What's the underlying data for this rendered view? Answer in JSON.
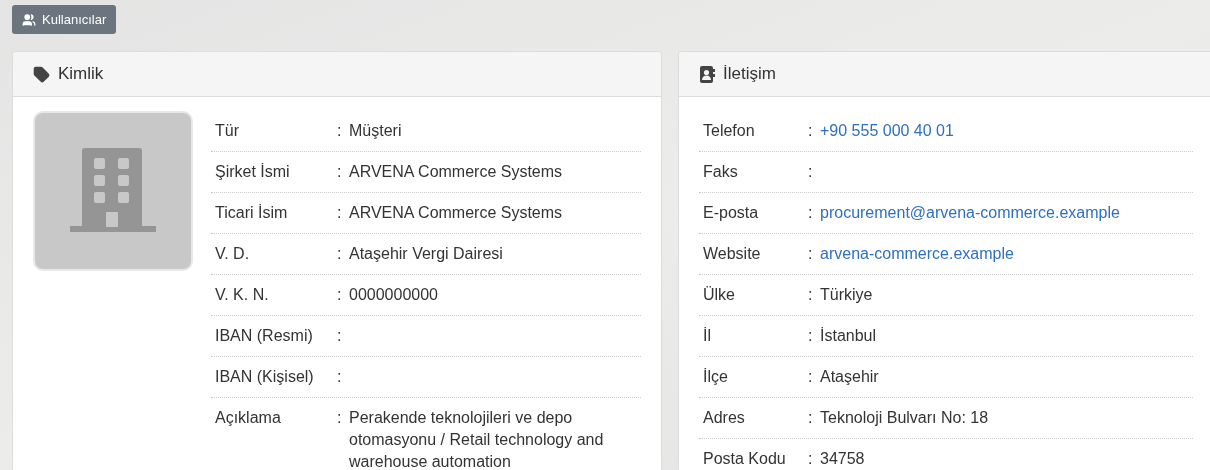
{
  "toolbar": {
    "button": "Kullanıcılar"
  },
  "identity": {
    "title": "Kimlik",
    "avatar": {
      "kind": "building"
    },
    "rows": [
      {
        "label": "Tür",
        "colon": ":",
        "value": "Müşteri",
        "kind": "text"
      },
      {
        "label": "Şirket İsmi",
        "colon": ":",
        "value": "ARVENA Commerce Systems",
        "kind": "text"
      },
      {
        "label": "Ticari İsim",
        "colon": ":",
        "value": "ARVENA Commerce Systems",
        "kind": "text"
      },
      {
        "label": "V. D.",
        "colon": ":",
        "value": "Ataşehir Vergi Dairesi",
        "kind": "text"
      },
      {
        "label": "V. K. N.",
        "colon": ":",
        "value": "0000000000",
        "kind": "text"
      },
      {
        "label": "IBAN (Resmi)",
        "colon": ":"
      },
      {
        "label": "IBAN (Kişisel)",
        "colon": ":"
      },
      {
        "label": "Açıklama",
        "colon": ":",
        "value": "Perakende teknolojileri ve depo otomasyonu / Retail technology and warehouse automation",
        "kind": "text"
      }
    ]
  },
  "contact": {
    "title": "İletişim",
    "rows": [
      {
        "label": "Telefon",
        "colon": ":",
        "value": "+90 555 000 40 01",
        "kind": "link"
      },
      {
        "label": "Faks",
        "colon": ":"
      },
      {
        "label": "E-posta",
        "colon": ":",
        "value": "procurement@arvena-commerce.example",
        "kind": "link"
      },
      {
        "label": "Website",
        "colon": ":",
        "value": "arvena-commerce.example",
        "kind": "link"
      },
      {
        "label": "Ülke",
        "colon": ":",
        "value": "Türkiye",
        "kind": "text"
      },
      {
        "label": "İl",
        "colon": ":",
        "value": "İstanbul",
        "kind": "text"
      },
      {
        "label": "İlçe",
        "colon": ":",
        "value": "Ataşehir",
        "kind": "text"
      },
      {
        "label": "Adres",
        "colon": ":",
        "value": "Teknoloji Bulvarı No: 18",
        "kind": "text"
      },
      {
        "label": "Posta Kodu",
        "colon": ":",
        "value": "34758",
        "kind": "text"
      }
    ]
  }
}
